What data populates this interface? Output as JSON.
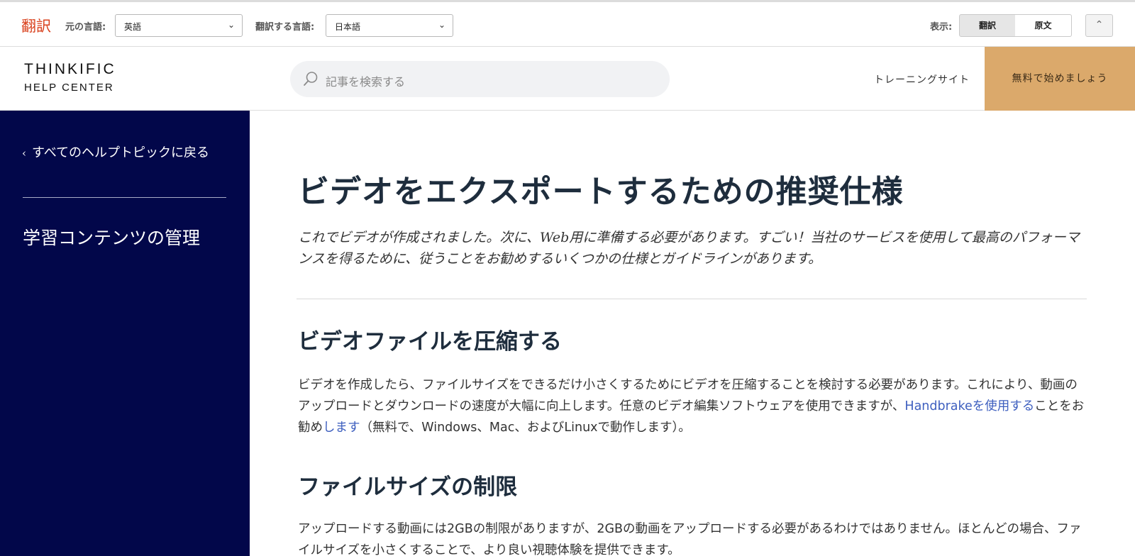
{
  "translate_bar": {
    "brand": "翻訳",
    "source_label": "元の言語:",
    "source_value": "英語",
    "target_label": "翻訳する言語:",
    "target_value": "日本語",
    "display_label": "表示:",
    "display_options": [
      "翻訳",
      "原文"
    ]
  },
  "header": {
    "logo_line1": "THINKIFIC",
    "logo_line2": "HELP CENTER",
    "search_placeholder": "記事を検索する",
    "nav_link": "トレーニングサイト",
    "cta": "無料で始めましょう"
  },
  "sidebar": {
    "back_label": "すべてのヘルプトピックに戻る",
    "section_title": "学習コンテンツの管理"
  },
  "article": {
    "title": "ビデオをエクスポートするための推奨仕様",
    "intro": "これでビデオが作成されました。次に、Web用に準備する必要があります。すごい！当社のサービスを使用して最高のパフォーマンスを得るために、従うことをお勧めするいくつかの仕様とガイドラインがあります。",
    "section1_title": "ビデオファイルを圧縮する",
    "section1_text_a": "ビデオを作成したら、ファイルサイズをできるだけ小さくするためにビデオを圧縮することを検討する必要があります。これにより、動画のアップロードとダウンロードの速度が大幅に向上します。任意のビデオ編集ソフトウェアを使用できますが、",
    "section1_link1": "Handbrakeを使用する",
    "section1_text_b": "ことをお勧め",
    "section1_link2": "します",
    "section1_text_c": "（無料で、Windows、Mac、およびLinuxで動作します）。",
    "section2_title": "ファイルサイズの制限",
    "section2_text": "アップロードする動画には2GBの制限がありますが、2GBの動画をアップロードする必要があるわけではありません。ほとんどの場合、ファイルサイズを小さくすることで、より良い視聴体験を提供できます。"
  },
  "colors": {
    "sidebar_bg": "#02074a",
    "cta_bg": "#dba96b",
    "link": "#3e5fbf",
    "brand_red": "#d9401c"
  }
}
